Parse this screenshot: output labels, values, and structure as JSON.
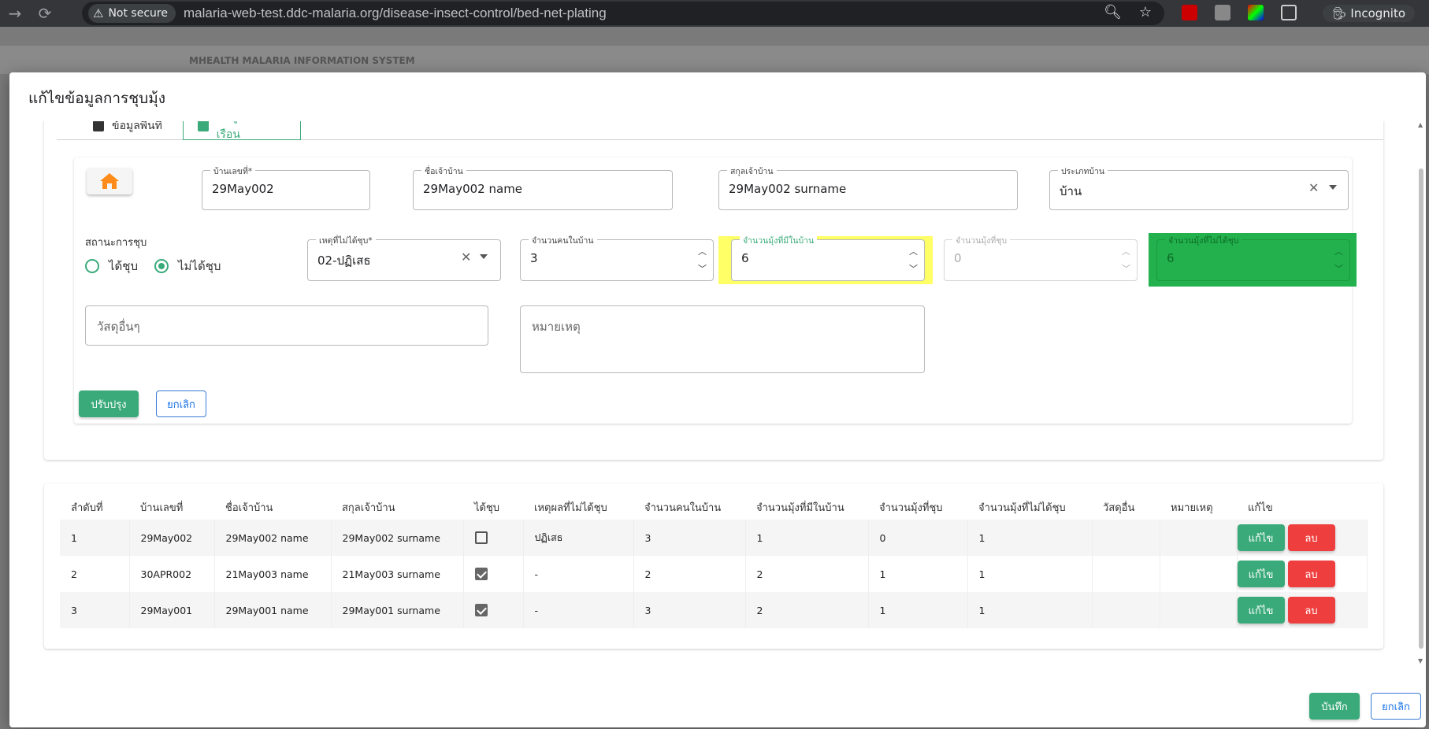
{
  "browser": {
    "security_label": "Not secure",
    "url": "malaria-web-test.ddc-malaria.org/disease-insect-control/bed-net-plating",
    "profile": "Incognito"
  },
  "background_app": {
    "title": "MHEALTH MALARIA INFORMATION SYSTEM"
  },
  "dialog": {
    "title": "แก้ไขข้อมูลการชุบมุ้ง",
    "tabs": [
      {
        "label": "ข้อมูลพื้นที่"
      },
      {
        "label": "ข้อมูลครัวเรือน"
      }
    ],
    "form": {
      "house_no": {
        "label": "บ้านเลขที่*",
        "value": "29May002"
      },
      "owner_name": {
        "label": "ชื่อเจ้าบ้าน",
        "value": "29May002 name"
      },
      "owner_surname": {
        "label": "สกุลเจ้าบ้าน",
        "value": "29May002 surname"
      },
      "house_type": {
        "label": "ประเภทบ้าน",
        "value": "บ้าน"
      },
      "status_title": "สถานะการชุบ",
      "radio_dipped": "ได้ชุบ",
      "radio_not_dipped": "ไม่ได้ชุบ",
      "reason": {
        "label": "เหตุที่ไม่ได้ชุบ*",
        "value": "02-ปฏิเสธ"
      },
      "people_count": {
        "label": "จำนวนคนในบ้าน",
        "value": "3"
      },
      "nets_in_house": {
        "label": "จำนวนมุ้งที่มีในบ้าน",
        "value": "6"
      },
      "nets_dipped": {
        "label": "จำนวนมุ้งที่ชุบ",
        "value": "0"
      },
      "nets_not_dipped": {
        "label": "จำนวนมุ้งที่ไม่ได้ชุบ",
        "value": "6"
      },
      "other_materials_placeholder": "วัสดุอื่นๆ",
      "remark_placeholder": "หมายเหตุ",
      "update_button": "ปรับปรุง",
      "cancel_button": "ยกเลิก"
    },
    "table": {
      "headers": [
        "ลำดับที่",
        "บ้านเลขที่",
        "ชื่อเจ้าบ้าน",
        "สกุลเจ้าบ้าน",
        "ได้ชุบ",
        "เหตุผลที่ไม่ได้ชุบ",
        "จำนวนคนในบ้าน",
        "จำนวนมุ้งที่มีในบ้าน",
        "จำนวนมุ้งที่ชุบ",
        "จำนวนมุ้งที่ไม่ได้ชุบ",
        "วัสดุอื่น",
        "หมายเหตุ",
        "แก้ไข"
      ],
      "rows": [
        {
          "no": "1",
          "house_no": "29May002",
          "name": "29May002 name",
          "surname": "29May002 surname",
          "dipped": false,
          "reason": "ปฏิเสธ",
          "people": "3",
          "nets": "1",
          "nets_dipped": "0",
          "nets_not_dipped": "1",
          "other": "",
          "remark": ""
        },
        {
          "no": "2",
          "house_no": "30APR002",
          "name": "21May003 name",
          "surname": "21May003 surname",
          "dipped": true,
          "reason": "-",
          "people": "2",
          "nets": "2",
          "nets_dipped": "1",
          "nets_not_dipped": "1",
          "other": "",
          "remark": ""
        },
        {
          "no": "3",
          "house_no": "29May001",
          "name": "29May001 name",
          "surname": "29May001 surname",
          "dipped": true,
          "reason": "-",
          "people": "3",
          "nets": "2",
          "nets_dipped": "1",
          "nets_not_dipped": "1",
          "other": "",
          "remark": ""
        }
      ],
      "edit_label": "แก้ไข",
      "delete_label": "ลบ"
    },
    "save_button": "บันทึก",
    "footer_cancel_button": "ยกเลิก"
  },
  "colors": {
    "accent_green": "#3aaa7a",
    "danger_red": "#ef3e3e",
    "highlight_yellow": "#ffff66",
    "highlight_green": "#22b14c",
    "home_orange": "#ff8c1a"
  }
}
